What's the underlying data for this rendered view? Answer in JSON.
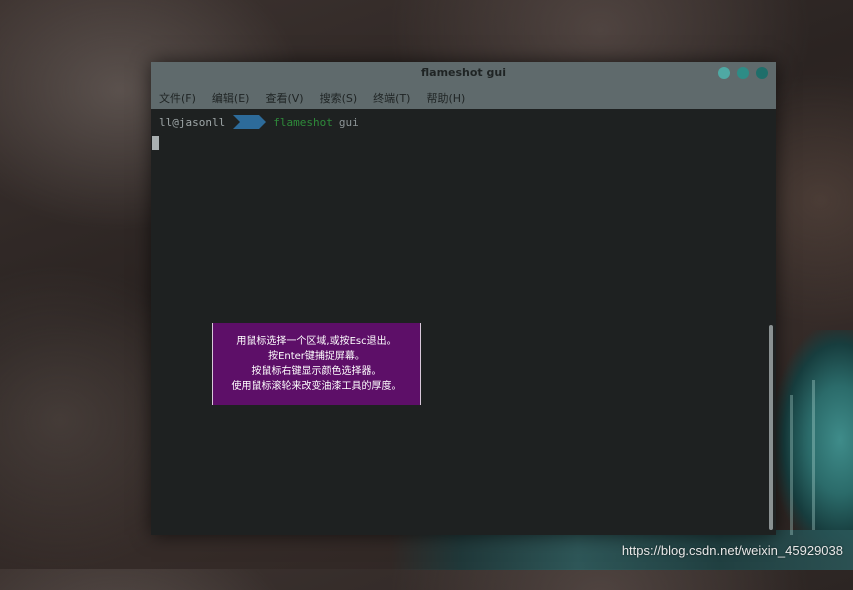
{
  "window": {
    "title": "flameshot gui",
    "controls": [
      "minimize",
      "maximize",
      "close"
    ]
  },
  "menubar": {
    "items": [
      {
        "label": "文件(F)"
      },
      {
        "label": "编辑(E)"
      },
      {
        "label": "查看(V)"
      },
      {
        "label": "搜索(S)"
      },
      {
        "label": "终端(T)"
      },
      {
        "label": "帮助(H)"
      }
    ]
  },
  "terminal": {
    "prompt_user": "ll@jasonll",
    "prompt_dir_icon": "home-arrow-segment",
    "command": "flameshot",
    "argument": "gui"
  },
  "help_overlay": {
    "lines": [
      "用鼠标选择一个区域,或按Esc退出。",
      "按Enter键捕捉屏幕。",
      "按鼠标右键显示颜色选择器。",
      "使用鼠标滚轮来改变油漆工具的厚度。"
    ],
    "background": "#5d0f68"
  },
  "watermark": {
    "text": "https://blog.csdn.net/weixin_45929038"
  },
  "colors": {
    "titlebar": "#5f6a6c",
    "terminal_bg": "#1e2121",
    "prompt_segment": "#2d6b9a",
    "command_green": "#2e8b3a",
    "window_buttons": [
      "#4fa9a4",
      "#2e8c86",
      "#1f6e6a"
    ]
  }
}
